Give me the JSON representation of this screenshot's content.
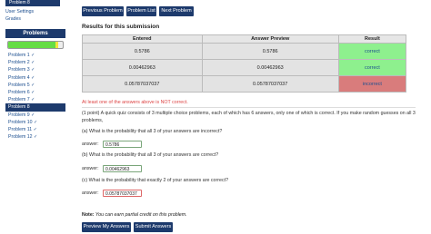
{
  "sidebar": {
    "top_item": "Problem 8",
    "links": [
      "User Settings",
      "Grades"
    ],
    "problems_header": "Problems",
    "progress": {
      "correct_fraction": 0.87,
      "incorrect_fraction": 0.05
    },
    "problems": [
      {
        "label": "Problem 1 ✓",
        "active": false
      },
      {
        "label": "Problem 2 ✓",
        "active": false
      },
      {
        "label": "Problem 3 ✓",
        "active": false
      },
      {
        "label": "Problem 4 ✓",
        "active": false
      },
      {
        "label": "Problem 5 ✓",
        "active": false
      },
      {
        "label": "Problem 6 ✓",
        "active": false
      },
      {
        "label": "Problem 7 ✓",
        "active": false
      },
      {
        "label": "Problem 8",
        "active": true
      },
      {
        "label": "Problem 9 ✓",
        "active": false
      },
      {
        "label": "Problem 10 ✓",
        "active": false
      },
      {
        "label": "Problem 11 ✓",
        "active": false
      },
      {
        "label": "Problem 12 ✓",
        "active": false
      }
    ]
  },
  "toolbar": {
    "prev_label": "Previous Problem",
    "list_label": "Problem List",
    "next_label": "Next Problem"
  },
  "results": {
    "title": "Results for this submission",
    "headers": [
      "Entered",
      "Answer Preview",
      "Result"
    ],
    "rows": [
      {
        "entered": "0.5786",
        "preview": "0.5786",
        "result": "correct"
      },
      {
        "entered": "0.00462963",
        "preview": "0.00462963",
        "result": "correct"
      },
      {
        "entered": "0.05787037037",
        "preview": "0.05787037037",
        "result": "incorrect"
      }
    ],
    "warning": "At least one of the answers above is NOT correct."
  },
  "problem": {
    "intro": "(1 point) A quick quiz consists of 3 multiple choice problems, each of which has 6 answers, only one of which is correct. If you make random guesses on all 3 problems,",
    "parts": [
      {
        "question": "(a)  What is the probability that all 3 of your answers are incorrect?",
        "label": "answer:",
        "value": "0.5786",
        "status": "correct"
      },
      {
        "question": "(b)  What is the probability that all 3 of your answers are correct?",
        "label": "answer:",
        "value": "0.00462963",
        "status": "correct"
      },
      {
        "question": "(c)  What is the probability that exactly 2 of your answers are correct?",
        "label": "answer:",
        "value": "0.05787037037",
        "status": "incorrect"
      }
    ]
  },
  "note": {
    "bold": "Note:",
    "text": " You can earn partial credit on this problem."
  },
  "actions": {
    "preview_label": "Preview My Answers",
    "submit_label": "Submit Answers"
  },
  "colors": {
    "nav": "#1d3a6c",
    "correct": "#8ef08e",
    "incorrect": "#d97c7c",
    "warning": "#dd4444"
  }
}
